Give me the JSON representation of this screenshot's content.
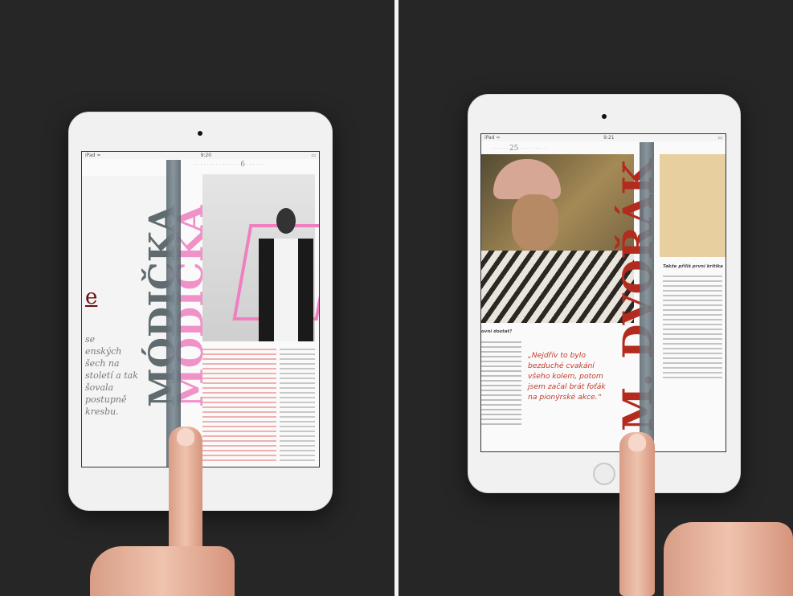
{
  "left_screen": {
    "title_vertical": "MÓDIČKA",
    "page_number": "6",
    "large_letter": "e",
    "body_copy": [
      "se",
      "enských",
      "šech na",
      "století a tak",
      "šovala",
      "postupně",
      "kresbu."
    ]
  },
  "right_screen": {
    "page_number": "25",
    "title_vertical": "M. DVOŘÁK",
    "question_heading": "ovní dostat?",
    "sidebar_heading": "Takže příliš první kritika",
    "pull_quote": [
      "„Nejdřív to bylo",
      "bezduché cvakání",
      "všeho kolem, potom",
      "jsem začal brát foťák",
      "na pionýrské akce.“"
    ]
  },
  "colors": {
    "background": "#262626",
    "tablet_bezel": "#f1f1f1",
    "left_title": "#5f6b6f",
    "pink_accent": "#ef7fc0",
    "right_title": "#b32a1f"
  }
}
